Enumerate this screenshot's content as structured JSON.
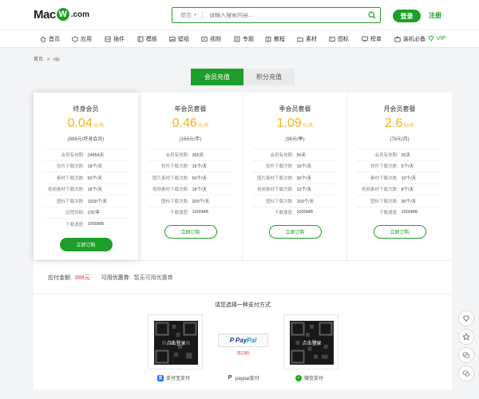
{
  "header": {
    "logo_mac": "Mac",
    "logo_w": "W",
    "logo_com": ".com",
    "search_category": "综合",
    "search_placeholder": "请输入搜索内容...",
    "login": "登录",
    "register": "注册"
  },
  "nav": {
    "items": [
      {
        "label": "首页",
        "icon": "home-icon"
      },
      {
        "label": "应用",
        "icon": "app-icon"
      },
      {
        "label": "插件",
        "icon": "plugin-icon"
      },
      {
        "label": "模板",
        "icon": "template-icon"
      },
      {
        "label": "壁纸",
        "icon": "wallpaper-icon"
      },
      {
        "label": "视频",
        "icon": "video-icon"
      },
      {
        "label": "专题",
        "icon": "topic-icon"
      },
      {
        "label": "教程",
        "icon": "tutorial-icon"
      },
      {
        "label": "素材",
        "icon": "folder-icon"
      },
      {
        "label": "图标",
        "icon": "icon-icon"
      },
      {
        "label": "榜单",
        "icon": "ranking-icon"
      },
      {
        "label": "装机必备",
        "icon": "briefcase-icon"
      },
      {
        "label": "VIP",
        "icon": "diamond-icon"
      }
    ]
  },
  "breadcrumb": {
    "home": "首页",
    "sep": ">",
    "current": "vip"
  },
  "tabs": {
    "active": "会员充值",
    "inactive": "积分充值"
  },
  "plans": [
    {
      "name": "终身会员",
      "price": "0.04",
      "unit": "元/天",
      "sub": "(888元/终身会员)",
      "rows": [
        {
          "k": "会员有效期:",
          "v": "24854天"
        },
        {
          "k": "软件下载次数:",
          "v": "18个/天"
        },
        {
          "k": "素材下载次数:",
          "v": "50个/天"
        },
        {
          "k": "视频素材下载次数:",
          "v": "18个/天"
        },
        {
          "k": "图标下载次数:",
          "v": "1500个/天"
        },
        {
          "k": "远程协助:",
          "v": "2次/年"
        },
        {
          "k": "下载速度:",
          "v": "1000MB"
        }
      ],
      "buy": "立即订购"
    },
    {
      "name": "年会员套餐",
      "price": "0.46",
      "unit": "元/天",
      "sub": "(168元/年)",
      "rows": [
        {
          "k": "会员有效期:",
          "v": "365天"
        },
        {
          "k": "软件下载次数:",
          "v": "15个/天"
        },
        {
          "k": "图片素材下载次数:",
          "v": "50个/天"
        },
        {
          "k": "视频素材下载次数:",
          "v": "18个/天"
        },
        {
          "k": "图标下载次数:",
          "v": "300个/天"
        },
        {
          "k": "下载速度:",
          "v": "1000MB"
        }
      ],
      "buy": "立即订购"
    },
    {
      "name": "季会员套餐",
      "price": "1.09",
      "unit": "元/天",
      "sub": "(98元/季)",
      "rows": [
        {
          "k": "会员有效期:",
          "v": "90天"
        },
        {
          "k": "软件下载次数:",
          "v": "10个/天"
        },
        {
          "k": "图片素材下载次数:",
          "v": "30个/天"
        },
        {
          "k": "视频素材下载次数:",
          "v": "12个/天"
        },
        {
          "k": "图标下载次数:",
          "v": "100个/天"
        },
        {
          "k": "下载速度:",
          "v": "1000MB"
        }
      ],
      "buy": "立即订购"
    },
    {
      "name": "月会员套餐",
      "price": "2.6",
      "unit": "元/天",
      "sub": "(78元/月)",
      "rows": [
        {
          "k": "会员有效期:",
          "v": "30天"
        },
        {
          "k": "软件下载次数:",
          "v": "5个/天"
        },
        {
          "k": "素材下载次数:",
          "v": "10个/天"
        },
        {
          "k": "视频素材下载次数:",
          "v": "8个/天"
        },
        {
          "k": "图标下载次数:",
          "v": "30个/天"
        },
        {
          "k": "下载速度:",
          "v": "1000MB"
        }
      ],
      "buy": "立即订购"
    }
  ],
  "amount": {
    "label": "应付金额:",
    "price": "888元",
    "coupon_label": "可用优惠券:",
    "coupon": "暂无可用优惠券"
  },
  "payment": {
    "title": "请您选择一种支付方式",
    "qr_mask": "点击登录",
    "paypal_price": "($138)",
    "paypal_text1": "Pay",
    "paypal_text2": "Pal",
    "alipay": "支付宝支付",
    "paypal": "paypal支付",
    "wechat": "微信支付"
  },
  "colors": {
    "brand": "#1e9e2a",
    "price": "#f2b21e",
    "red": "#e4393c"
  }
}
